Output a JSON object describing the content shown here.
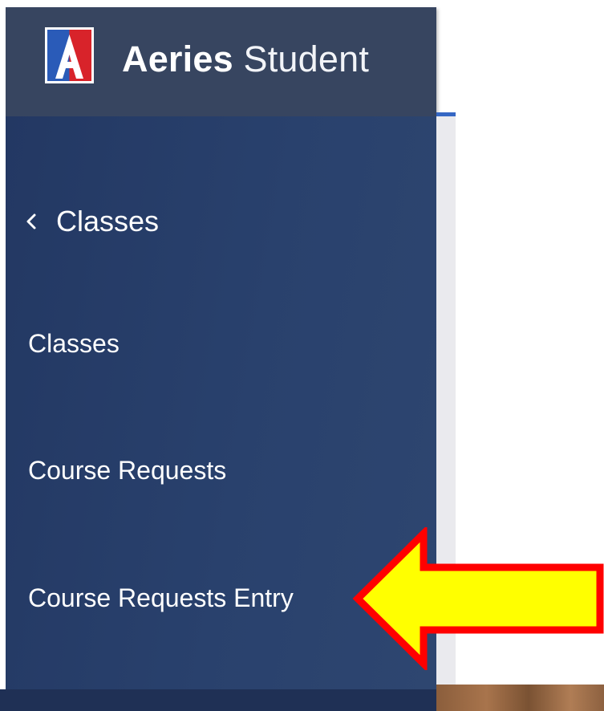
{
  "header": {
    "brand_bold": "Aeries",
    "brand_light": "Student",
    "logo_letter": "A"
  },
  "sidebar": {
    "back_label": "Classes",
    "items": [
      {
        "label": "Classes"
      },
      {
        "label": "Course Requests"
      },
      {
        "label": "Course Requests Entry"
      }
    ]
  },
  "colors": {
    "header_bg": "#374560",
    "sidebar_bg": "#263d69",
    "accent": "#3567c4",
    "arrow_fill": "#ffff00",
    "arrow_stroke": "#ff0000",
    "logo_blue": "#2a5bb8",
    "logo_red": "#d8232a"
  },
  "icons": {
    "back": "chevron-left-icon",
    "annotation": "arrow-left-icon"
  }
}
